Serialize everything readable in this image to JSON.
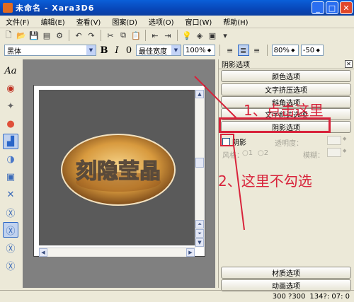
{
  "window": {
    "title": "未命名 - Xara3D6"
  },
  "menu": [
    "文件(F)",
    "编辑(E)",
    "查看(V)",
    "图案(D)",
    "选项(O)",
    "窗口(W)",
    "帮助(H)"
  ],
  "toolbar2": {
    "font": "黑体",
    "bold": "B",
    "italic": "I",
    "outline": "0",
    "width_mode": "最佳宽度",
    "zoom": "100%",
    "char_scale": "80%",
    "spacing": "-50"
  },
  "left_tools": [
    "Aa",
    "🎨",
    "✦",
    "●",
    "▦",
    "◐",
    "▣",
    "✕",
    "✕",
    "✕",
    "✕",
    "✕"
  ],
  "artwork": {
    "text": "刻隐莹晶",
    "note": "3D extruded text on oval photo"
  },
  "panel": {
    "title": "阴影选项",
    "buttons": [
      "颜色选项",
      "文字挤压选项",
      "斜角选项",
      "文字斜边选项",
      "阴影选项"
    ],
    "shadow_checkbox_label": "阴影",
    "transparency_label": "透明度：",
    "style_label": "风格：",
    "style_opts": [
      "1",
      "2"
    ],
    "blur_label": "模糊：",
    "bottom_buttons": [
      "材质选项",
      "动画选项"
    ]
  },
  "annotations": {
    "step1": "1、点击这里",
    "step2": "2、这里不勾选"
  },
  "status": {
    "size": "300 ?300",
    "coords": "134?: 07: 0"
  }
}
